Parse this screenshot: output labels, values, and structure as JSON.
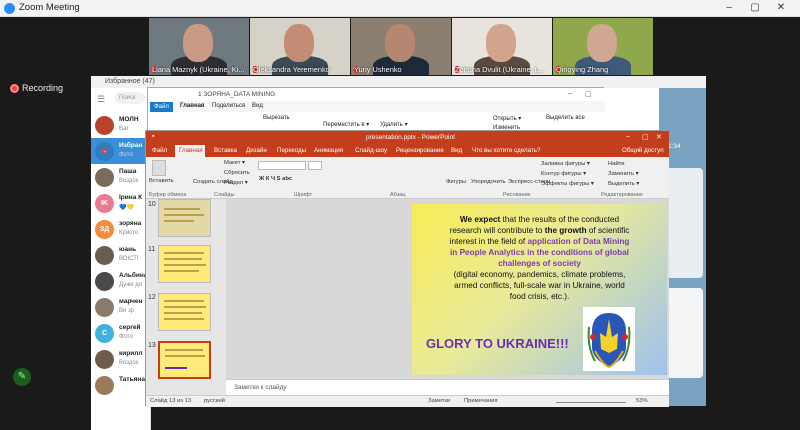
{
  "zoom": {
    "title": "Zoom Meeting",
    "recording": "Recording",
    "participants": [
      {
        "name": "Liana Maznyk (Ukraine, Ki..."
      },
      {
        "name": "Oleksandra Yeremenko"
      },
      {
        "name": "Yuriy Ushenko"
      },
      {
        "name": "Zoriana Dvulit (Ukraine, L..."
      },
      {
        "name": "Qingying Zhang"
      }
    ]
  },
  "telegram": {
    "title": "Избранное (47)",
    "search": "Поиск",
    "chats": [
      {
        "initials": "",
        "name": "МОЛН",
        "preview": "Bат",
        "color": "#b9442d"
      },
      {
        "initials": "",
        "name": "Избран",
        "preview": "Фото",
        "color": "#3a8fd8"
      },
      {
        "initials": "",
        "name": "Паша",
        "preview": "Воздох",
        "color": "#7a6b5a"
      },
      {
        "initials": "IK",
        "name": "Ірина К",
        "preview": "💙💛",
        "color": "#e77b8f"
      },
      {
        "initials": "ЗД",
        "name": "зоряна",
        "preview": "Кристо",
        "color": "#f08c3c"
      },
      {
        "initials": "",
        "name": "юань",
        "preview": "ВОІСТІ",
        "color": "#6b5d4d"
      },
      {
        "initials": "",
        "name": "Альбина",
        "preview": "Дуже дя",
        "color": "#4c4a48"
      },
      {
        "initials": "",
        "name": "марчен",
        "preview": "Ви зр",
        "color": "#8a7a6a"
      },
      {
        "initials": "С",
        "name": "сергей",
        "preview": "Фото",
        "color": "#3fb2e0"
      },
      {
        "initials": "",
        "name": "кирилл",
        "preview": "Воздох",
        "color": "#6f5c4a"
      },
      {
        "initials": "",
        "name": "Татьяна",
        "preview": "",
        "color": "#9b7a5a"
      }
    ],
    "time": "11:34"
  },
  "explorer": {
    "title": "1 ЗОРЯНА_DATA MINING",
    "tabs": {
      "file": "Файл",
      "home": "Главная",
      "share": "Поделиться",
      "view": "Вид"
    },
    "ribbon": {
      "cut": "Вырезать",
      "move": "Переместить в ▾",
      "delete": "Удалить ▾",
      "open": "Открыть ▾",
      "change": "Изменить",
      "select_all": "Выделить все"
    }
  },
  "powerpoint": {
    "title": "presentation.pptx - PowerPoint",
    "tabs": [
      "Файл",
      "Главная",
      "Вставка",
      "Дизайн",
      "Переходы",
      "Анимация",
      "Слайд-шоу",
      "Рецензирование",
      "Вид"
    ],
    "tell_me": "Что вы хотите сделать?",
    "share": "Общий доступ",
    "ribbon": {
      "paste": "Вставить",
      "create_slide": "Создать слайд",
      "layout": "Макет ▾",
      "reset": "Сбросить",
      "section": "Раздел ▾",
      "shapes": "Фигуры",
      "arrange": "Упорядочить",
      "quick_styles": "Экспресс-стили",
      "fill": "Заливка фигуры ▾",
      "outline": "Контур фигуры ▾",
      "effects": "Эффекты фигуры ▾",
      "find": "Найти",
      "replace": "Заменить ▾",
      "select": "Выделить ▾",
      "groups": {
        "clipboard": "Буфер обмена",
        "slides": "Слайды",
        "font": "Шрифт",
        "paragraph": "Абзац",
        "drawing": "Рисование",
        "editing": "Редактирование"
      }
    },
    "thumbs": [
      "10",
      "11",
      "12",
      "13"
    ],
    "notes_placeholder": "Заметки к слайду",
    "status": {
      "slide": "Слайд 13 из 13",
      "lang": "русский",
      "notes": "Заметки",
      "comments": "Примечания",
      "zoom": "53%"
    }
  },
  "slide": {
    "line1_bold": "We expect",
    "line1_rest": " that the results of the conducted",
    "line2_a": "research will contribute to ",
    "line2_bold": "the growth",
    "line2_b": " of scientific",
    "line3_a": "interest in the field of ",
    "line3_purple": "application of Data Mining",
    "line4": "in People Analytics in the conditions of global",
    "line5": "challenges of society",
    "line6": "(digital economy, pandemics, climate problems,",
    "line7": "armed conflicts, full-scale war in Ukraine, world",
    "line8": "food crisis, etc.).",
    "glory": "GLORY TO UKRAINE!!!"
  }
}
